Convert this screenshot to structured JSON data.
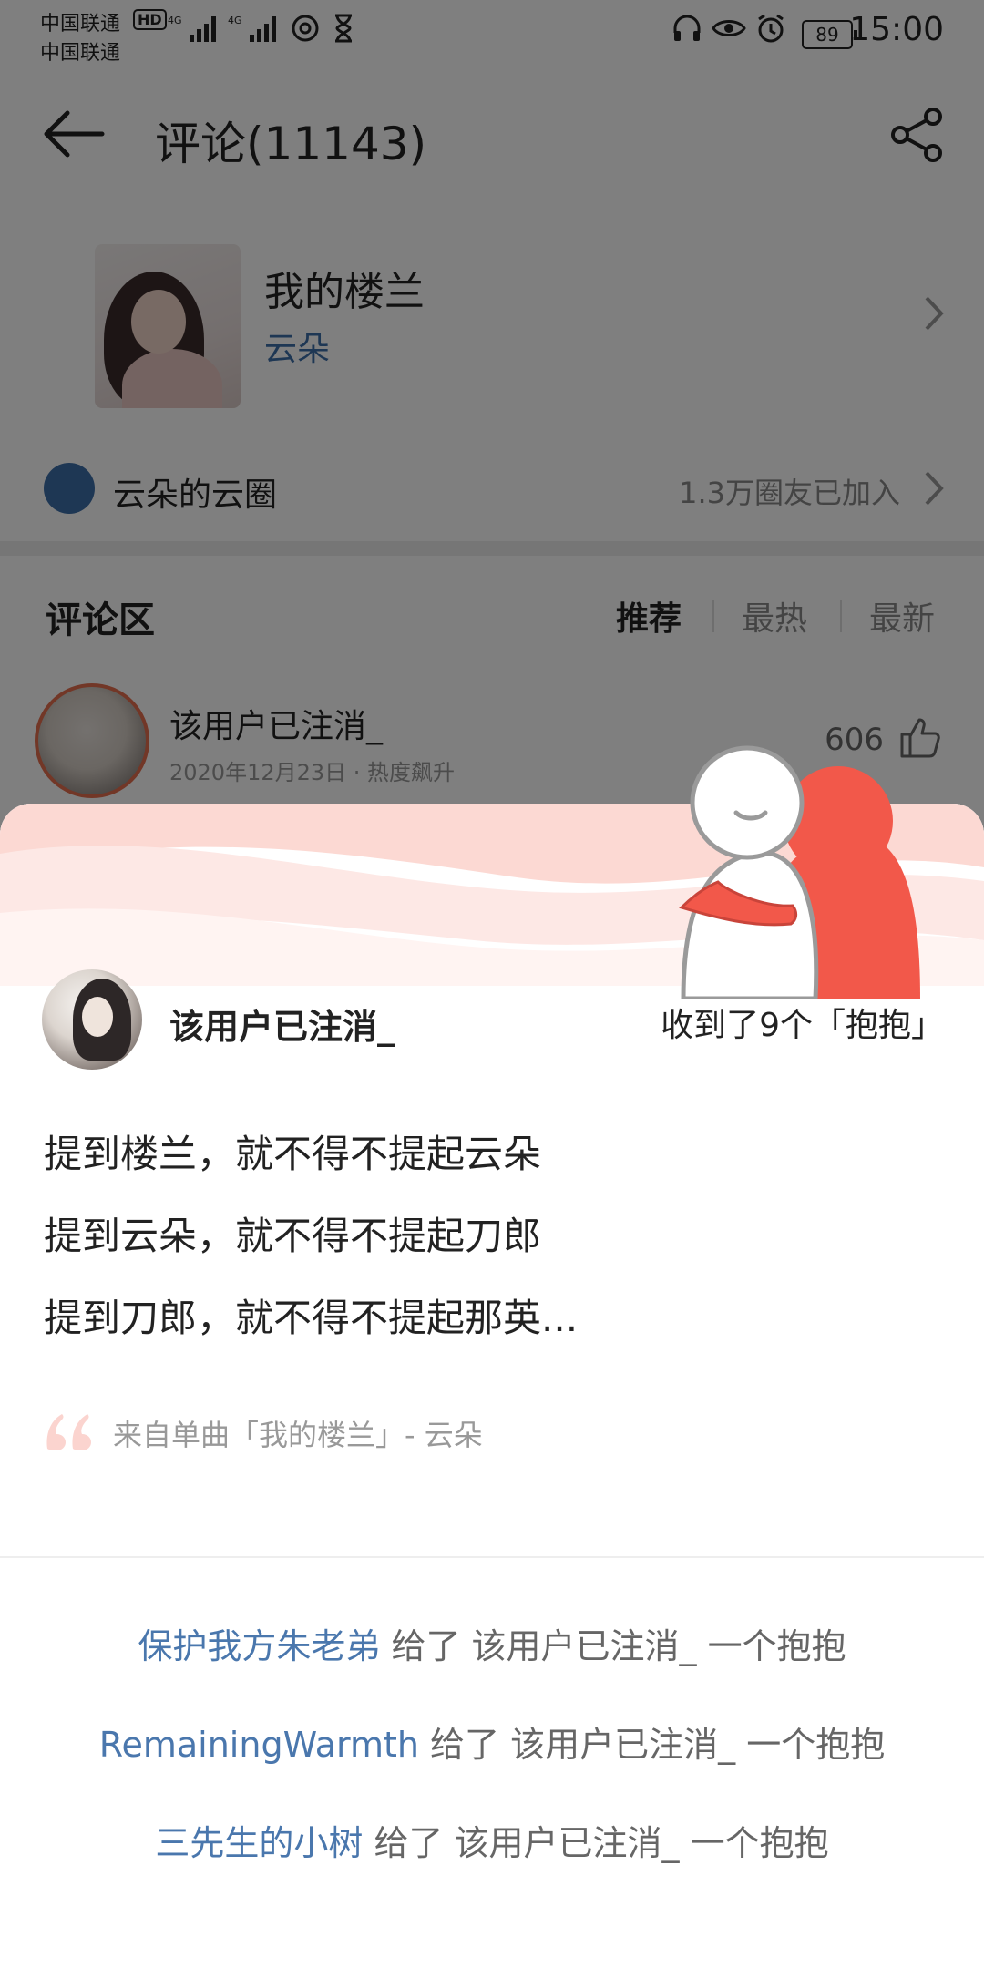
{
  "status": {
    "carrier_1": "中国联通",
    "carrier_2": "中国联通",
    "hd_badge": "HD",
    "network_1": "4G",
    "network_2": "4G",
    "battery": "89",
    "time": "15:00"
  },
  "header": {
    "title": "评论(11143)"
  },
  "song": {
    "title": "我的楼兰",
    "artist": "云朵"
  },
  "circle": {
    "name": "云朵的云圈",
    "members": "1.3万圈友已加入"
  },
  "comments": {
    "section_title": "评论区",
    "tabs": [
      "推荐",
      "最热",
      "最新"
    ],
    "active_tab": "推荐",
    "preview": {
      "user": "该用户已注消_",
      "meta": "2020年12月23日 · 热度飙升",
      "likes": "606"
    }
  },
  "sheet": {
    "user": "该用户已注消_",
    "hug_count_text": "收到了9个「抱抱」",
    "quote_lines": [
      "提到楼兰，就不得不提起云朵",
      "提到云朵，就不得不提起刀郎",
      "提到刀郎，就不得不提起那英..."
    ],
    "source": "来自单曲「我的楼兰」- 云朵",
    "hugs": [
      {
        "from": "保护我方朱老弟",
        "text": " 给了 该用户已注消_ 一个抱抱"
      },
      {
        "from": "RemainingWarmth",
        "text": " 给了 该用户已注消_ 一个抱抱"
      },
      {
        "from": "三先生的小树",
        "text": " 给了 该用户已注消_ 一个抱抱"
      }
    ]
  },
  "colors": {
    "link_blue": "#4a77ad",
    "artist_blue": "#3d6ea8",
    "hug_red": "#f2584a",
    "wave_pink": "#fde3df"
  }
}
